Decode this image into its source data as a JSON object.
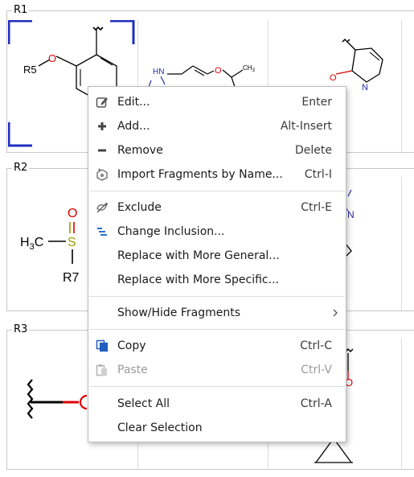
{
  "groups": [
    {
      "label": "R1"
    },
    {
      "label": "R2"
    },
    {
      "label": "R3"
    }
  ],
  "molecule_labels": {
    "r1_cell1_substituent": "R5",
    "r1_cell1_oxygen": "O",
    "r1_cell2_nh": "HN",
    "r1_cell2_o": "O",
    "r1_cell2_ch3": "CH",
    "r1_cell2_ch3_sub": "3",
    "r1_cell3_o": "O",
    "r1_cell3_n": "N",
    "r2_cell1_h3c_h": "H",
    "r2_cell1_h3c_3": "3",
    "r2_cell1_h3c_c": "C",
    "r2_cell1_s": "S",
    "r2_cell1_o": "O",
    "r2_cell1_r7": "R7",
    "r2_cell3_n": "N",
    "r3_cell3_o": "O"
  },
  "context_menu": {
    "items": [
      {
        "label": "Edit...",
        "shortcut": "Enter",
        "icon": "edit-icon"
      },
      {
        "label": "Add...",
        "shortcut": "Alt-Insert",
        "icon": "plus-icon"
      },
      {
        "label": "Remove",
        "shortcut": "Delete",
        "icon": "minus-icon"
      },
      {
        "label": "Import Fragments by Name...",
        "shortcut": "Ctrl-I",
        "icon": "import-icon"
      },
      {
        "label": "Exclude",
        "shortcut": "Ctrl-E",
        "icon": "exclude-icon"
      },
      {
        "label": "Change Inclusion...",
        "shortcut": "",
        "icon": "inclusion-icon"
      },
      {
        "label": "Replace with More General...",
        "shortcut": "",
        "icon": ""
      },
      {
        "label": "Replace with More Specific...",
        "shortcut": "",
        "icon": ""
      },
      {
        "label": "Show/Hide Fragments",
        "shortcut": "",
        "icon": "",
        "submenu": true
      },
      {
        "label": "Copy",
        "shortcut": "Ctrl-C",
        "icon": "copy-icon"
      },
      {
        "label": "Paste",
        "shortcut": "Ctrl-V",
        "icon": "paste-icon",
        "disabled": true
      },
      {
        "label": "Select All",
        "shortcut": "Ctrl-A",
        "icon": ""
      },
      {
        "label": "Clear Selection",
        "shortcut": "",
        "icon": ""
      }
    ]
  },
  "colors": {
    "selection": "#1f2fbf",
    "oxygen": "#dd0000",
    "nitrogen": "#2a2aa8",
    "sulfur": "#9a9a00",
    "bond": "#000000"
  }
}
